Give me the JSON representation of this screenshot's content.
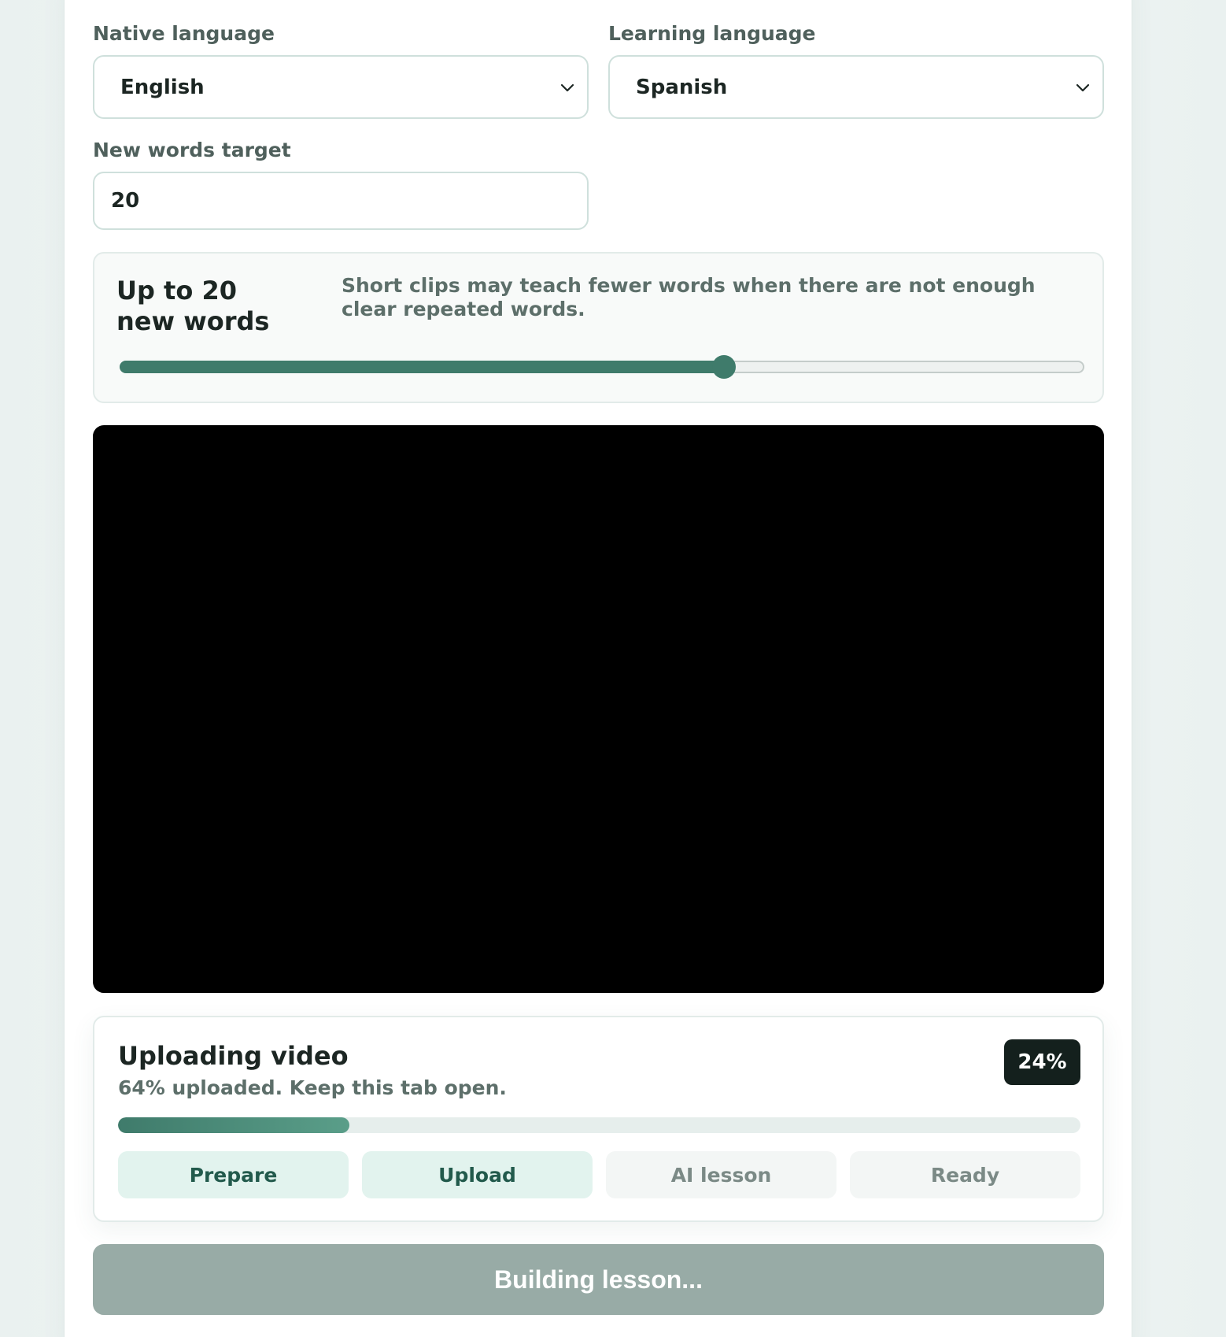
{
  "form": {
    "native_label": "Native language",
    "native_value": "English",
    "learning_label": "Learning language",
    "learning_value": "Spanish",
    "target_label": "New words target",
    "target_value": "20"
  },
  "words_panel": {
    "title": "Up to 20 new words",
    "hint": "Short clips may teach fewer words when there are not enough clear repeated words.",
    "slider_fraction": 0.627
  },
  "upload": {
    "title": "Uploading video",
    "subtitle": "64% uploaded. Keep this tab open.",
    "badge": "24%",
    "progress_fraction": 0.24,
    "steps": [
      {
        "label": "Prepare",
        "state": "done"
      },
      {
        "label": "Upload",
        "state": "done"
      },
      {
        "label": "AI lesson",
        "state": "pending"
      },
      {
        "label": "Ready",
        "state": "pending"
      }
    ]
  },
  "build_button": "Building lesson...",
  "colors": {
    "accent": "#3f7b6b",
    "badge_bg": "#14201d",
    "button_disabled": "#98aba6"
  }
}
